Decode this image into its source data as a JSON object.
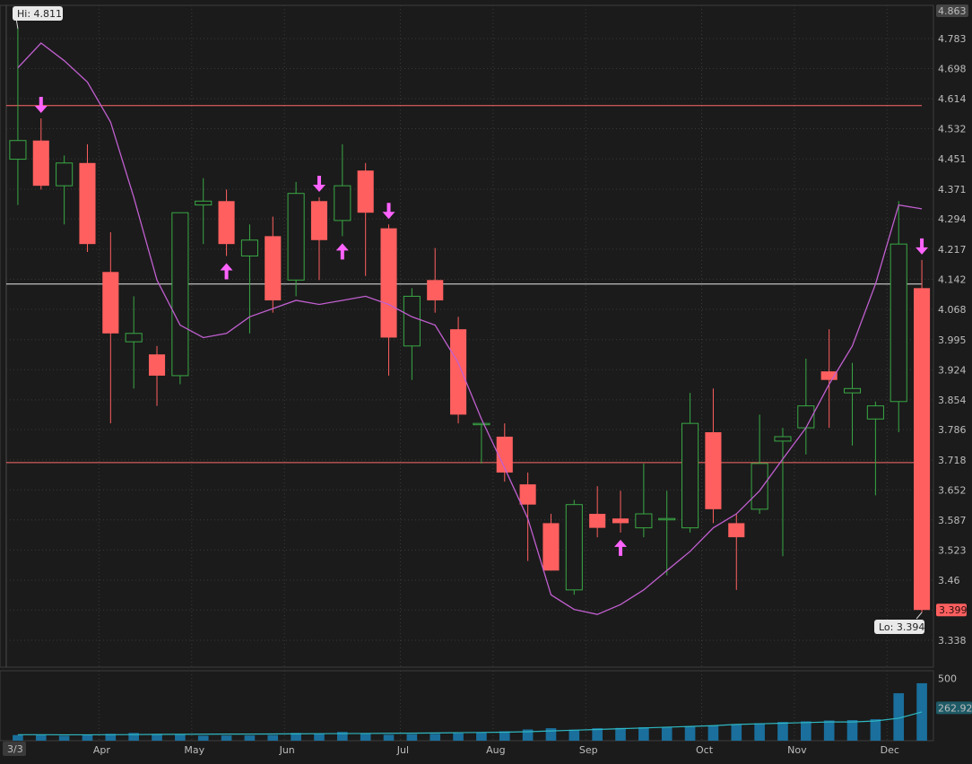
{
  "chart_data": {
    "type": "candlestick",
    "title": "",
    "period": "weekly",
    "colors": {
      "background": "#1b1b1b",
      "up": "#39a845",
      "down": "#ff5f5f",
      "moving_average": "#c15fd0",
      "volume": "#1a6f9c",
      "volume_average": "#2fb8c2",
      "signal_arrow": "#ff63ff",
      "grid": "#3a3a3a"
    },
    "y_axis": {
      "range": [
        3.31,
        4.87
      ],
      "ticks": [
        "4.863",
        "4.783",
        "4.698",
        "4.614",
        "4.532",
        "4.451",
        "4.371",
        "4.294",
        "4.217",
        "4.142",
        "4.068",
        "3.995",
        "3.924",
        "3.854",
        "3.786",
        "3.718",
        "3.652",
        "3.587",
        "3.523",
        "3.46",
        "3.399",
        "3.338"
      ],
      "ticks_numeric": [
        4.863,
        4.783,
        4.698,
        4.614,
        4.532,
        4.451,
        4.371,
        4.294,
        4.217,
        4.142,
        4.068,
        3.995,
        3.924,
        3.854,
        3.786,
        3.718,
        3.652,
        3.587,
        3.523,
        3.46,
        3.399,
        3.338
      ],
      "log_scale": true
    },
    "x_axis": {
      "labels": [
        "3/3",
        "Apr",
        "May",
        "Jun",
        "Jul",
        "Aug",
        "Sep",
        "Oct",
        "Nov",
        "Dec"
      ],
      "label_week_index": [
        0,
        4,
        8,
        12,
        17,
        21,
        25,
        30,
        34,
        38
      ]
    },
    "hi_label": "Hi: 4.811",
    "hi_value": 4.811,
    "lo_label": "Lo: 3.394",
    "lo_value": 3.394,
    "last_price_label": "3.399",
    "last_price": 3.399,
    "horizontal_lines": [
      4.595,
      4.13,
      3.712
    ],
    "horizontal_line_colors": [
      "#ff6b6b",
      "#e8e8e8",
      "#ff6b6b"
    ],
    "candles": [
      {
        "o": 4.45,
        "h": 4.811,
        "l": 4.33,
        "c": 4.5
      },
      {
        "o": 4.5,
        "h": 4.56,
        "l": 4.37,
        "c": 4.38
      },
      {
        "o": 4.38,
        "h": 4.46,
        "l": 4.28,
        "c": 4.44
      },
      {
        "o": 4.44,
        "h": 4.49,
        "l": 4.21,
        "c": 4.23
      },
      {
        "o": 4.16,
        "h": 4.26,
        "l": 3.8,
        "c": 4.01
      },
      {
        "o": 3.99,
        "h": 4.1,
        "l": 3.88,
        "c": 4.01
      },
      {
        "o": 3.96,
        "h": 3.98,
        "l": 3.84,
        "c": 3.91
      },
      {
        "o": 3.91,
        "h": 4.31,
        "l": 3.89,
        "c": 4.31
      },
      {
        "o": 4.33,
        "h": 4.4,
        "l": 4.23,
        "c": 4.34
      },
      {
        "o": 4.34,
        "h": 4.37,
        "l": 4.2,
        "c": 4.23
      },
      {
        "o": 4.2,
        "h": 4.28,
        "l": 4.01,
        "c": 4.24
      },
      {
        "o": 4.25,
        "h": 4.3,
        "l": 4.06,
        "c": 4.09
      },
      {
        "o": 4.14,
        "h": 4.39,
        "l": 4.1,
        "c": 4.36
      },
      {
        "o": 4.34,
        "h": 4.35,
        "l": 4.14,
        "c": 4.24
      },
      {
        "o": 4.29,
        "h": 4.49,
        "l": 4.25,
        "c": 4.38
      },
      {
        "o": 4.42,
        "h": 4.44,
        "l": 4.15,
        "c": 4.31
      },
      {
        "o": 4.27,
        "h": 4.28,
        "l": 3.91,
        "c": 4.0
      },
      {
        "o": 3.98,
        "h": 4.12,
        "l": 3.9,
        "c": 4.1
      },
      {
        "o": 4.14,
        "h": 4.22,
        "l": 4.06,
        "c": 4.09
      },
      {
        "o": 4.02,
        "h": 4.05,
        "l": 3.8,
        "c": 3.82
      },
      {
        "o": 3.8,
        "h": 3.8,
        "l": 3.71,
        "c": 3.8
      },
      {
        "o": 3.77,
        "h": 3.8,
        "l": 3.67,
        "c": 3.69
      },
      {
        "o": 3.664,
        "h": 3.69,
        "l": 3.5,
        "c": 3.62
      },
      {
        "o": 3.58,
        "h": 3.6,
        "l": 3.48,
        "c": 3.48
      },
      {
        "o": 3.44,
        "h": 3.63,
        "l": 3.43,
        "c": 3.62
      },
      {
        "o": 3.6,
        "h": 3.66,
        "l": 3.55,
        "c": 3.57
      },
      {
        "o": 3.59,
        "h": 3.65,
        "l": 3.56,
        "c": 3.58
      },
      {
        "o": 3.57,
        "h": 3.71,
        "l": 3.55,
        "c": 3.6
      },
      {
        "o": 3.59,
        "h": 3.65,
        "l": 3.47,
        "c": 3.59
      },
      {
        "o": 3.57,
        "h": 3.87,
        "l": 3.56,
        "c": 3.8
      },
      {
        "o": 3.78,
        "h": 3.88,
        "l": 3.58,
        "c": 3.61
      },
      {
        "o": 3.58,
        "h": 3.6,
        "l": 3.44,
        "c": 3.55
      },
      {
        "o": 3.61,
        "h": 3.82,
        "l": 3.6,
        "c": 3.71
      },
      {
        "o": 3.76,
        "h": 3.79,
        "l": 3.51,
        "c": 3.77
      },
      {
        "o": 3.79,
        "h": 3.95,
        "l": 3.73,
        "c": 3.84
      },
      {
        "o": 3.92,
        "h": 4.02,
        "l": 3.79,
        "c": 3.9
      },
      {
        "o": 3.87,
        "h": 3.94,
        "l": 3.75,
        "c": 3.88
      },
      {
        "o": 3.81,
        "h": 3.85,
        "l": 3.64,
        "c": 3.84
      },
      {
        "o": 3.85,
        "h": 4.34,
        "l": 3.78,
        "c": 4.23
      },
      {
        "o": 4.12,
        "h": 4.19,
        "l": 3.394,
        "c": 3.399
      }
    ],
    "moving_average": [
      4.7,
      4.77,
      4.72,
      4.66,
      4.55,
      4.35,
      4.14,
      4.03,
      4.0,
      4.01,
      4.05,
      4.07,
      4.09,
      4.08,
      4.09,
      4.1,
      4.08,
      4.05,
      4.03,
      3.94,
      3.81,
      3.7,
      3.59,
      3.43,
      3.4,
      3.39,
      3.41,
      3.44,
      3.48,
      3.52,
      3.57,
      3.6,
      3.65,
      3.72,
      3.79,
      3.89,
      3.98,
      4.13,
      4.33,
      4.32
    ],
    "signal_arrows": [
      {
        "week": 1,
        "direction": "down"
      },
      {
        "week": 9,
        "direction": "up"
      },
      {
        "week": 13,
        "direction": "down"
      },
      {
        "week": 14,
        "direction": "up"
      },
      {
        "week": 16,
        "direction": "down"
      },
      {
        "week": 26,
        "direction": "up"
      },
      {
        "week": 39,
        "direction": "down"
      }
    ],
    "volume": {
      "ticks": [
        "500",
        "262.92"
      ],
      "ticks_numeric": [
        500,
        262.92
      ],
      "range": [
        0,
        560
      ],
      "values": [
        45,
        45,
        40,
        45,
        55,
        62,
        55,
        50,
        40,
        42,
        42,
        45,
        62,
        55,
        70,
        60,
        48,
        52,
        55,
        60,
        68,
        75,
        90,
        100,
        88,
        100,
        102,
        108,
        108,
        115,
        120,
        128,
        140,
        150,
        155,
        162,
        165,
        172,
        380,
        460
      ],
      "average": [
        48,
        48,
        47,
        47,
        48,
        49,
        50,
        51,
        52,
        53,
        53,
        54,
        55,
        56,
        57,
        58,
        59,
        60,
        62,
        64,
        66,
        68,
        72,
        78,
        84,
        90,
        96,
        102,
        108,
        114,
        120,
        130,
        135,
        140,
        145,
        150,
        150,
        158,
        180,
        230
      ]
    }
  }
}
